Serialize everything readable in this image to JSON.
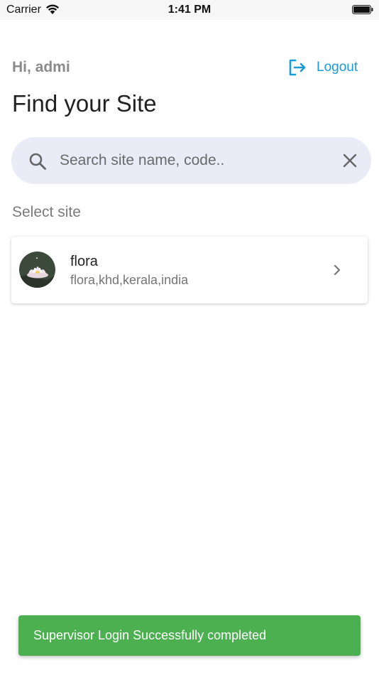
{
  "status_bar": {
    "carrier": "Carrier",
    "time": "1:41 PM"
  },
  "header": {
    "greeting": "Hi, admi",
    "logout_label": "Logout"
  },
  "page_title": "Find your Site",
  "search": {
    "placeholder": "Search site name, code..",
    "value": ""
  },
  "section_label": "Select site",
  "sites": [
    {
      "name": "flora",
      "subtitle": "flora,khd,kerala,india"
    }
  ],
  "snackbar": {
    "message": "Supervisor Login Successfully completed"
  },
  "colors": {
    "accent": "#1a9ad6",
    "search_background": "#e9ecf7",
    "snackbar_background": "#4caf50"
  },
  "icons": {
    "status": [
      "wifi-icon",
      "battery-icon"
    ],
    "logout": "logout-icon",
    "search": "search-icon",
    "clear": "clear-icon",
    "row_chevron": "chevron-right-icon"
  }
}
